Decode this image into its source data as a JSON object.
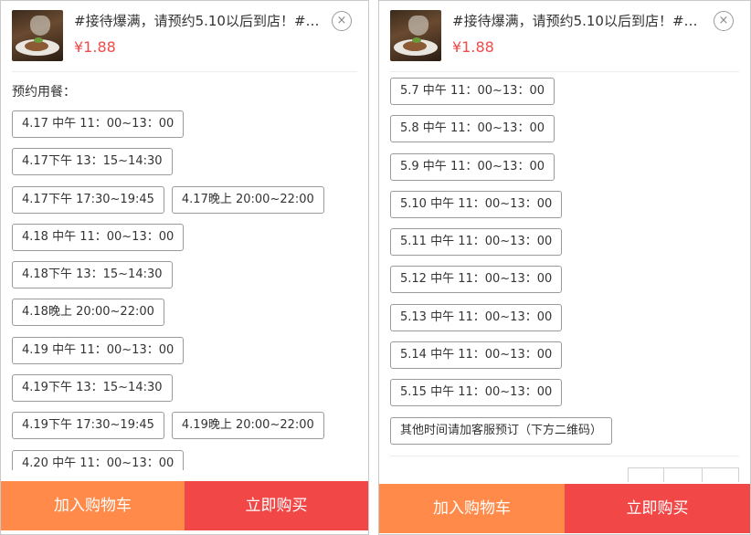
{
  "product": {
    "title": "#接待爆满，请预约5.10以后到店！#…",
    "price": "¥1.88"
  },
  "icons": {
    "close": "×"
  },
  "left_panel": {
    "section_label": "预约用餐：",
    "options": [
      [
        "4.17 中午 11：00~13：00"
      ],
      [
        "4.17下午 13：15~14:30"
      ],
      [
        "4.17下午 17:30~19:45",
        "4.17晚上 20:00~22:00"
      ],
      [
        "4.18 中午 11：00~13：00"
      ],
      [
        "4.18下午 13：15~14:30"
      ],
      [
        "4.18晚上 20:00~22:00"
      ],
      [
        "4.19 中午 11：00~13：00"
      ],
      [
        "4.19下午 13：15~14:30"
      ],
      [
        "4.19下午 17:30~19:45",
        "4.19晚上 20:00~22:00"
      ],
      [
        "4.20 中午 11：00~13：00"
      ]
    ]
  },
  "right_panel": {
    "options": [
      [
        "5.7 中午 11：00~13：00"
      ],
      [
        "5.8 中午 11：00~13：00"
      ],
      [
        "5.9 中午 11：00~13：00"
      ],
      [
        "5.10 中午 11：00~13：00"
      ],
      [
        "5.11 中午 11：00~13：00"
      ],
      [
        "5.12 中午 11：00~13：00"
      ],
      [
        "5.13 中午 11：00~13：00"
      ],
      [
        "5.14 中午 11：00~13：00"
      ],
      [
        "5.15 中午 11：00~13：00"
      ],
      [
        "其他时间请加客服预订（下方二维码）"
      ]
    ]
  },
  "footer": {
    "add_to_cart": "加入购物车",
    "buy_now": "立即购买"
  },
  "colors": {
    "price": "#f24a4a",
    "cart_button": "#ff8a4a",
    "buy_button": "#f24747"
  }
}
